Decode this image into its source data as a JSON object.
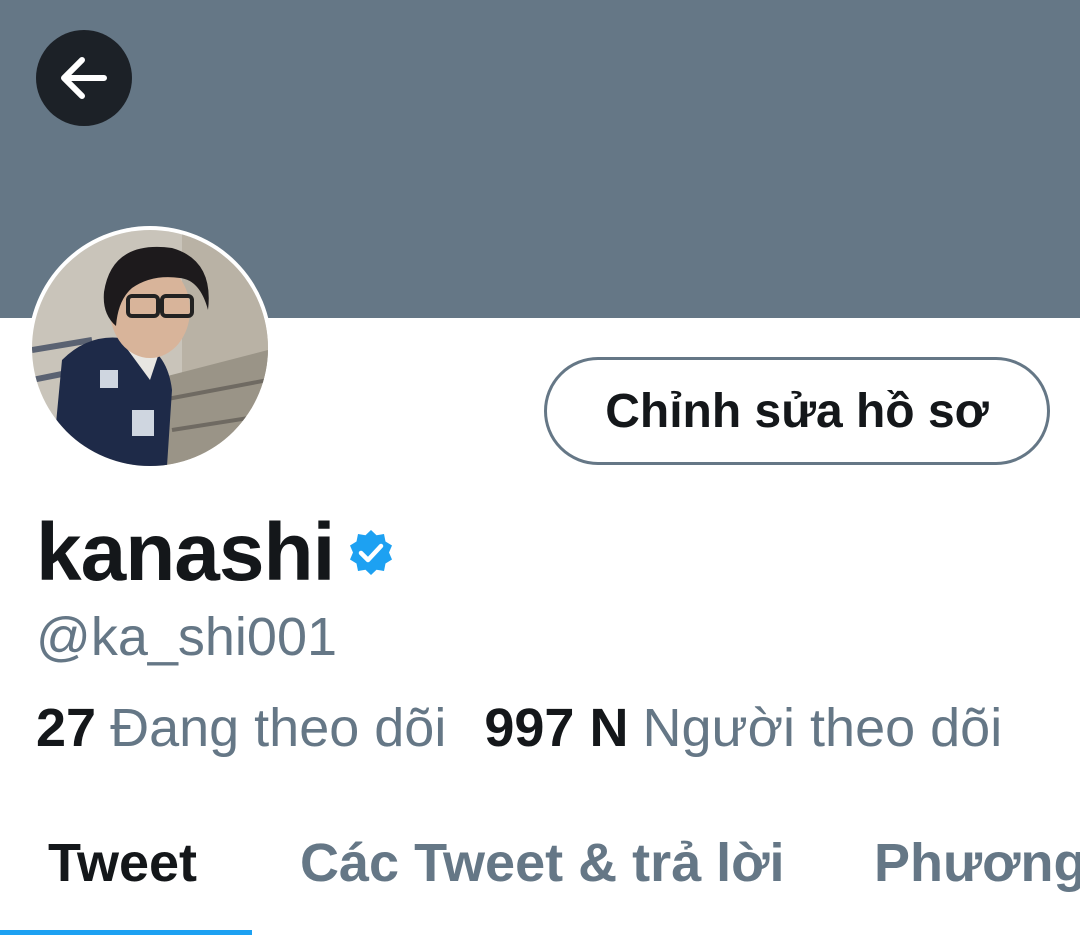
{
  "header": {
    "banner_color": "#657786",
    "back_icon": "arrow-left-icon"
  },
  "profile": {
    "avatar_alt": "Profile photo",
    "edit_button_label": "Chỉnh sửa hồ sơ",
    "display_name": "kanashi",
    "verified_icon": "verified-badge-icon",
    "verified_color": "#1da1f2",
    "handle": "@ka_shi001"
  },
  "stats": {
    "following_count": "27",
    "following_label": "Đang theo dõi",
    "followers_count": "997 N",
    "followers_label": "Người theo dõi"
  },
  "tabs": [
    {
      "label": "Tweet",
      "active": true
    },
    {
      "label": "Các Tweet & trả lời",
      "active": false
    },
    {
      "label": "Phương",
      "active": false
    }
  ],
  "colors": {
    "accent": "#1da1f2",
    "text_primary": "#14171a",
    "text_secondary": "#657786"
  }
}
